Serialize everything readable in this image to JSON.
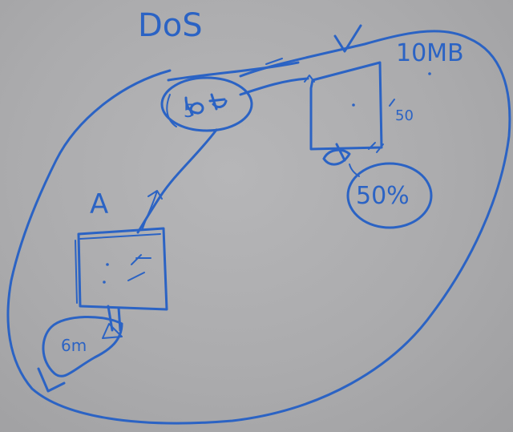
{
  "colors": {
    "ink": "#2b63c4",
    "board": "#ababad"
  },
  "labels": {
    "title": "DoS",
    "node_a": "A",
    "node_b": "10MB",
    "a_bandwidth": "6m",
    "b_small": "50",
    "b_percent": "50%",
    "attacker_blob": "5"
  }
}
